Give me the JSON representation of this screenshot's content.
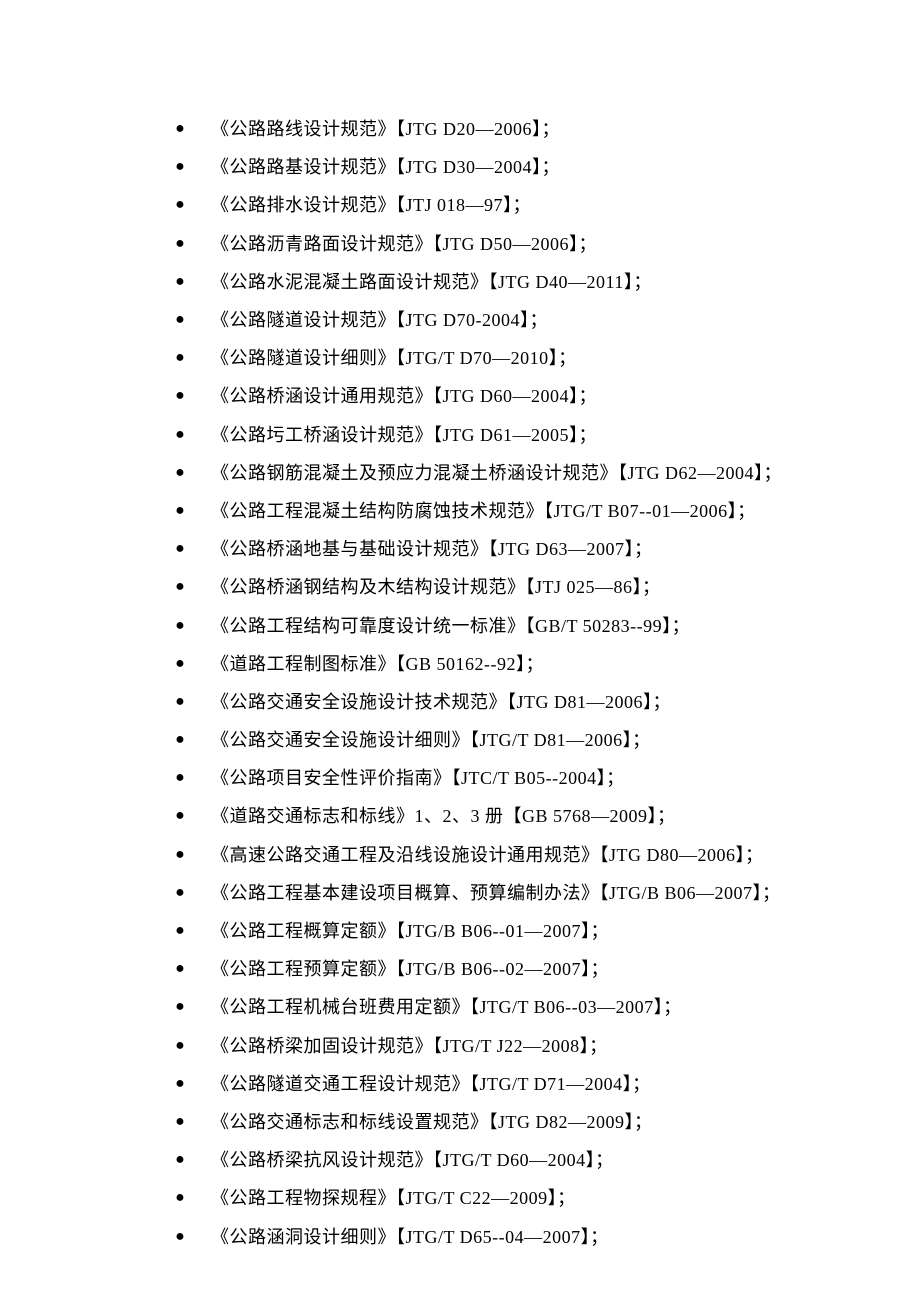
{
  "items": [
    "《公路路线设计规范》【JTG D20—2006】；",
    "《公路路基设计规范》【JTG D30—2004】；",
    "《公路排水设计规范》【JTJ 018—97】；",
    "《公路沥青路面设计规范》【JTG D50—2006】；",
    "《公路水泥混凝土路面设计规范》【JTG D40—2011】；",
    "《公路隧道设计规范》【JTG D70-2004】；",
    "《公路隧道设计细则》【JTG/T D70—2010】；",
    "《公路桥涵设计通用规范》【JTG D60—2004】；",
    "《公路圬工桥涵设计规范》【JTG D61—2005】；",
    "《公路钢筋混凝土及预应力混凝土桥涵设计规范》【JTG D62—2004】；",
    "《公路工程混凝土结构防腐蚀技术规范》【JTG/T B07--01—2006】；",
    "《公路桥涵地基与基础设计规范》【JTG D63—2007】；",
    "《公路桥涵钢结构及木结构设计规范》【JTJ 025—86】；",
    "《公路工程结构可靠度设计统一标准》【GB/T 50283--99】；",
    "《道路工程制图标准》【GB 50162--92】；",
    "《公路交通安全设施设计技术规范》【JTG D81—2006】；",
    "《公路交通安全设施设计细则》【JTG/T D81—2006】；",
    "《公路项目安全性评价指南》【JTC/T B05--2004】；",
    "《道路交通标志和标线》1、2、3 册【GB 5768—2009】；",
    "《高速公路交通工程及沿线设施设计通用规范》【JTG D80—2006】；",
    "《公路工程基本建设项目概算、预算编制办法》【JTG/B B06—2007】；",
    "《公路工程概算定额》【JTG/B B06--01—2007】；",
    "《公路工程预算定额》【JTG/B B06--02—2007】；",
    "《公路工程机械台班费用定额》【JTG/T B06--03—2007】；",
    "《公路桥梁加固设计规范》【JTG/T J22—2008】；",
    "《公路隧道交通工程设计规范》【JTG/T D71—2004】；",
    "《公路交通标志和标线设置规范》【JTG D82—2009】；",
    "《公路桥梁抗风设计规范》【JTG/T D60—2004】；",
    "《公路工程物探规程》【JTG/T C22—2009】；",
    "《公路涵洞设计细则》【JTG/T D65--04—2007】；"
  ]
}
